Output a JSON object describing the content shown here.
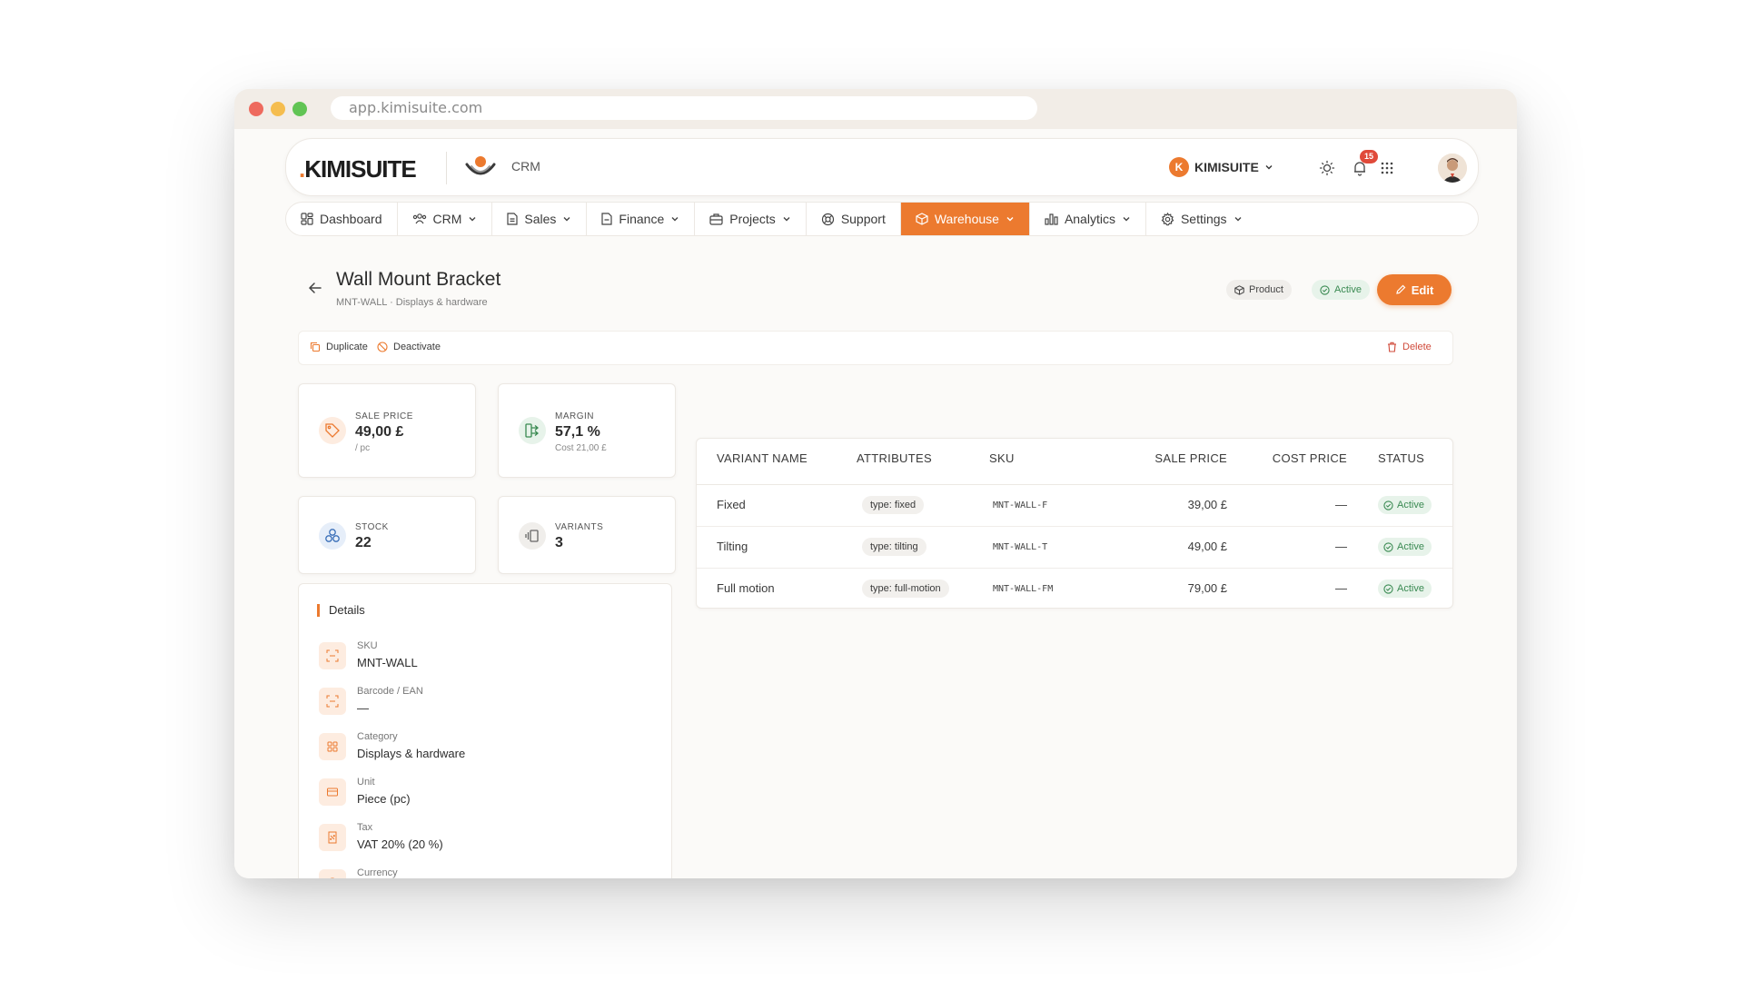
{
  "browser": {
    "url": "app.kimisuite.com"
  },
  "header": {
    "logo_dot": ".",
    "logo_text": "KIMISUITE",
    "app_label": "CRM",
    "org_initial": "K",
    "org_name": "KIMISUITE",
    "notification_count": "15",
    "icons": [
      "theme-sun-icon",
      "bell-icon",
      "apps-grid-icon",
      "avatar"
    ]
  },
  "nav": {
    "items": [
      {
        "label": "Dashboard",
        "icon": "dashboard-icon"
      },
      {
        "label": "CRM",
        "icon": "users-icon"
      },
      {
        "label": "Sales",
        "icon": "document-icon"
      },
      {
        "label": "Finance",
        "icon": "file-icon"
      },
      {
        "label": "Projects",
        "icon": "briefcase-icon"
      },
      {
        "label": "Support",
        "icon": "lifebuoy-icon"
      },
      {
        "label": "Warehouse",
        "icon": "box-icon",
        "active": true
      },
      {
        "label": "Analytics",
        "icon": "bar-chart-icon"
      },
      {
        "label": "Settings",
        "icon": "gear-icon"
      }
    ]
  },
  "page": {
    "title": "Wall Mount Bracket",
    "subtitle": "MNT-WALL · Displays & hardware",
    "type_chip": "Product",
    "status_chip": "Active",
    "edit_label": "Edit",
    "actions": {
      "duplicate": "Duplicate",
      "deactivate": "Deactivate",
      "delete": "Delete"
    }
  },
  "stats": {
    "sale_price": {
      "label": "SALE PRICE",
      "value": "49,00 £",
      "sub": "/ pc"
    },
    "margin": {
      "label": "MARGIN",
      "value": "57,1 %",
      "sub": "Cost 21,00 £"
    },
    "stock": {
      "label": "STOCK",
      "value": "22"
    },
    "variants": {
      "label": "VARIANTS",
      "value": "3"
    }
  },
  "details": {
    "title": "Details",
    "rows": [
      {
        "label": "SKU",
        "value": "MNT-WALL"
      },
      {
        "label": "Barcode / EAN",
        "value": "—"
      },
      {
        "label": "Category",
        "value": "Displays & hardware"
      },
      {
        "label": "Unit",
        "value": "Piece (pc)"
      },
      {
        "label": "Tax",
        "value": "VAT 20% (20 %)"
      },
      {
        "label": "Currency",
        "value": ""
      }
    ]
  },
  "variants_table": {
    "columns": [
      "VARIANT NAME",
      "ATTRIBUTES",
      "SKU",
      "SALE PRICE",
      "COST PRICE",
      "STATUS"
    ],
    "rows": [
      {
        "name": "Fixed",
        "attributes": "type: fixed",
        "sku": "MNT-WALL-F",
        "sale_price": "39,00 £",
        "cost_price": "—",
        "status": "Active"
      },
      {
        "name": "Tilting",
        "attributes": "type: tilting",
        "sku": "MNT-WALL-T",
        "sale_price": "49,00 £",
        "cost_price": "—",
        "status": "Active"
      },
      {
        "name": "Full motion",
        "attributes": "type: full-motion",
        "sku": "MNT-WALL-FM",
        "sale_price": "79,00 £",
        "cost_price": "—",
        "status": "Active"
      }
    ]
  },
  "colors": {
    "accent": "#ec7a2f",
    "success": "#3a8a52",
    "danger": "#d04a3a"
  }
}
